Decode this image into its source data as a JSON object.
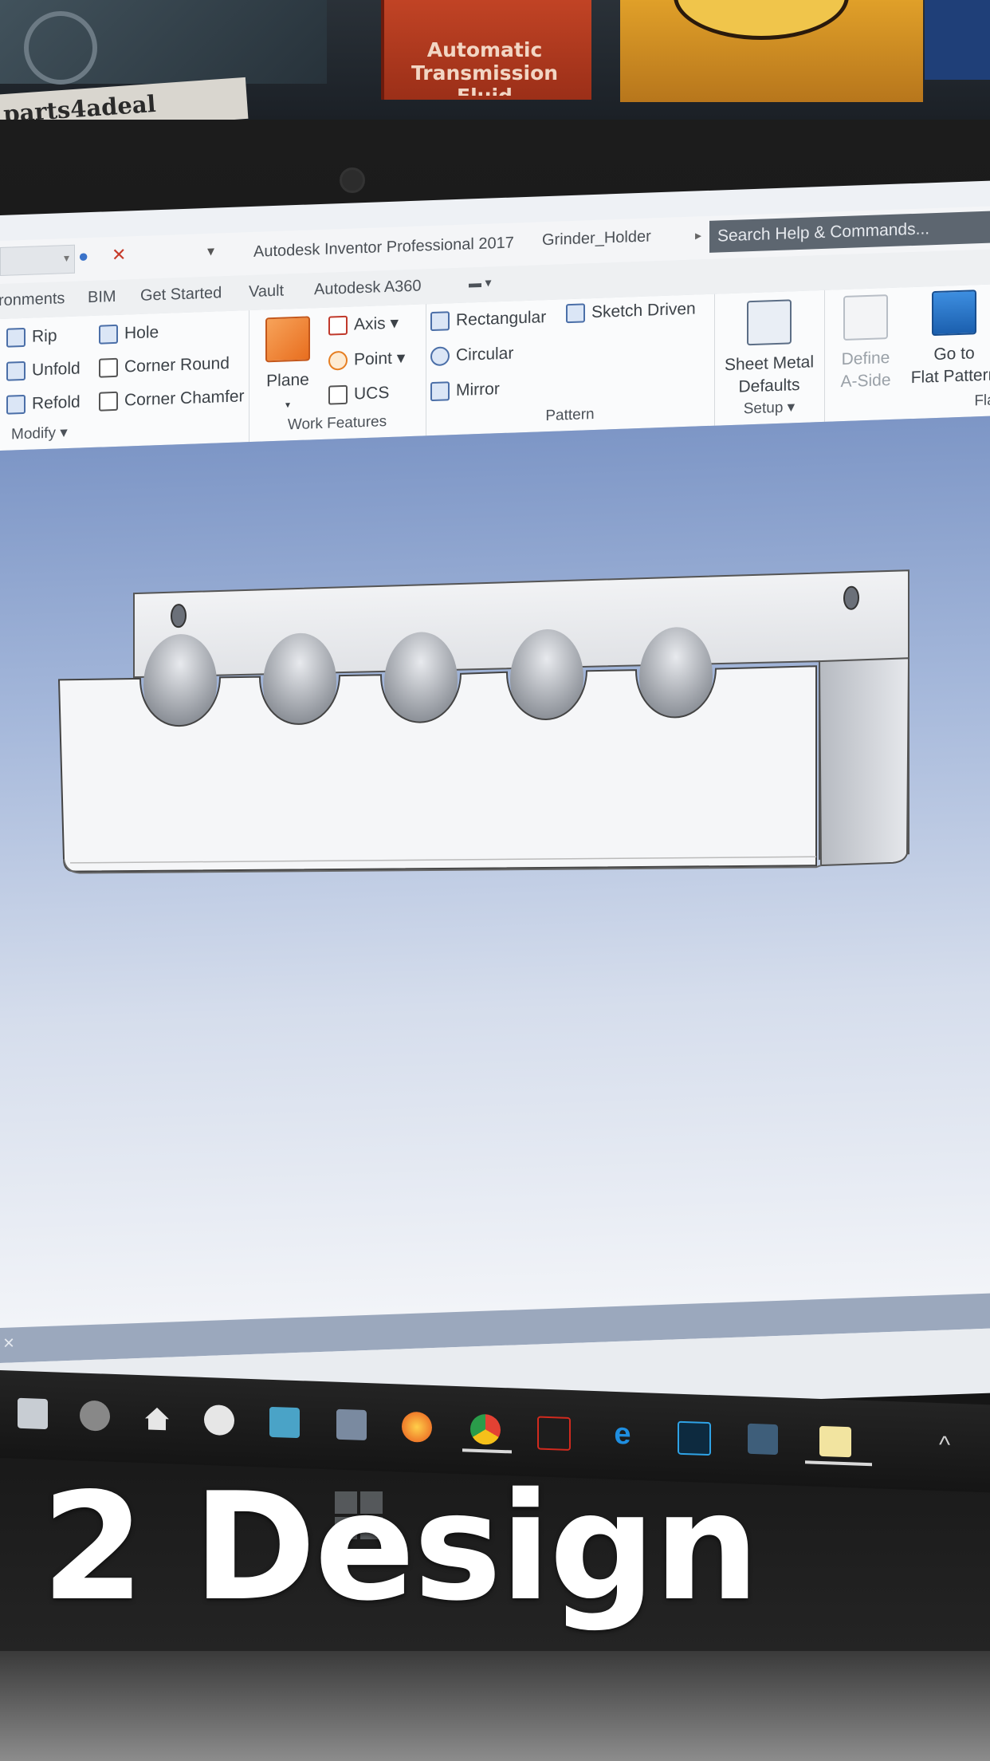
{
  "background": {
    "can_label_lines": [
      "Automatic",
      "Transmission",
      "Fluid"
    ],
    "sticker_text": "parts4adeal"
  },
  "titlebar": {
    "app_title": "Autodesk Inventor Professional 2017",
    "document_name": "Grinder_Holder",
    "search_placeholder": "Search Help & Commands..."
  },
  "tabs": [
    "ronments",
    "BIM",
    "Get Started",
    "Vault",
    "Autodesk A360"
  ],
  "ribbon": {
    "modify": {
      "label": "Modify",
      "col1": [
        "Rip",
        "Unfold",
        "Refold"
      ],
      "col2": [
        "Hole",
        "Corner Round",
        "Corner Chamfer"
      ]
    },
    "work_features": {
      "label": "Work Features",
      "plane": "Plane",
      "items": [
        "Axis",
        "Point",
        "UCS"
      ]
    },
    "pattern": {
      "label": "Pattern",
      "items": [
        "Rectangular",
        "Circular",
        "Mirror"
      ],
      "sketch_driven": "Sketch Driven"
    },
    "setup": {
      "label": "Setup",
      "sheet_metal_defaults": [
        "Sheet Metal",
        "Defaults"
      ]
    },
    "flat": {
      "label": "Flat",
      "define_a_side": [
        "Define",
        "A-Side"
      ],
      "go_to_flat_pattern": [
        "Go to",
        "Flat Pattern"
      ]
    }
  },
  "statusbar": {
    "close_glyph": "×"
  },
  "taskbar": {
    "icons": [
      "store-icon",
      "webcam-app-icon",
      "home-icon",
      "hp-icon",
      "mail-icon",
      "amazon-icon",
      "firefox-icon",
      "chrome-icon",
      "acrobat-icon",
      "edge-icon",
      "photoshop-icon",
      "kindle-icon",
      "sticky-notes-icon"
    ],
    "chevron": "^"
  },
  "caption": "2 Design",
  "colors": {
    "viewport_top": "#7d96c6",
    "part_fill": "#f3f4f6",
    "search_box": "#5d6670",
    "caption": "#ffffff"
  }
}
